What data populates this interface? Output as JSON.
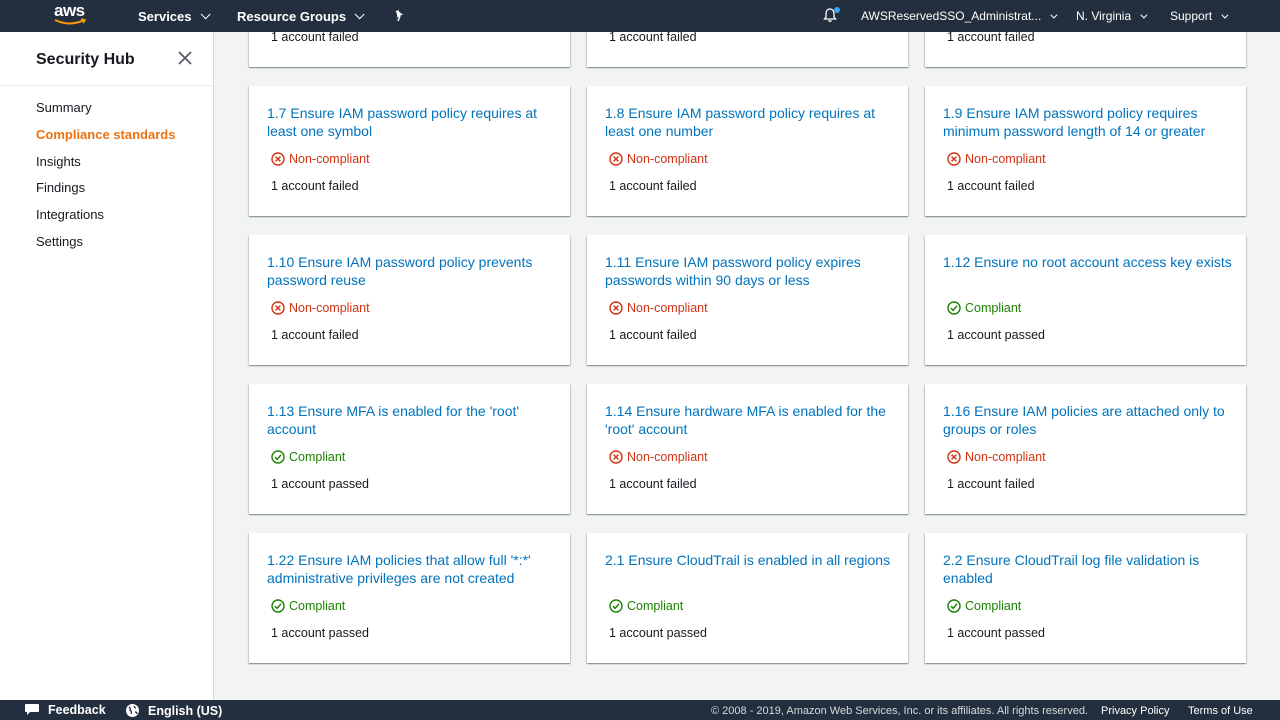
{
  "topnav": {
    "logo_text": "aws",
    "services": "Services",
    "resource_groups": "Resource Groups",
    "account": "AWSReservedSSO_Administrat...",
    "region": "N. Virginia",
    "support": "Support"
  },
  "sidebar": {
    "title": "Security Hub",
    "items": [
      {
        "label": "Summary"
      },
      {
        "label": "Compliance standards",
        "active": true
      },
      {
        "label": "Insights"
      },
      {
        "label": "Findings"
      },
      {
        "label": "Integrations"
      },
      {
        "label": "Settings"
      }
    ]
  },
  "partial_cards": [
    {
      "count": "1 account failed"
    },
    {
      "count": "1 account failed"
    },
    {
      "count": "1 account failed"
    }
  ],
  "cards": [
    {
      "title": "1.7 Ensure IAM password policy requires at least one symbol",
      "status": "Non-compliant",
      "count": "1 account failed"
    },
    {
      "title": "1.8 Ensure IAM password policy requires at least one number",
      "status": "Non-compliant",
      "count": "1 account failed"
    },
    {
      "title": "1.9 Ensure IAM password policy requires minimum password length of 14 or greater",
      "status": "Non-compliant",
      "count": "1 account failed"
    },
    {
      "title": "1.10 Ensure IAM password policy prevents password reuse",
      "status": "Non-compliant",
      "count": "1 account failed"
    },
    {
      "title": "1.11 Ensure IAM password policy expires passwords within 90 days or less",
      "status": "Non-compliant",
      "count": "1 account failed"
    },
    {
      "title": "1.12 Ensure no root account access key exists",
      "status": "Compliant",
      "count": "1 account passed"
    },
    {
      "title": "1.13 Ensure MFA is enabled for the 'root' account",
      "status": "Compliant",
      "count": "1 account passed"
    },
    {
      "title": "1.14 Ensure hardware MFA is enabled for the 'root' account",
      "status": "Non-compliant",
      "count": "1 account failed"
    },
    {
      "title": "1.16 Ensure IAM policies are attached only to groups or roles",
      "status": "Non-compliant",
      "count": "1 account failed"
    },
    {
      "title": "1.22 Ensure IAM policies that allow full '*:*' administrative privileges are not created",
      "status": "Compliant",
      "count": "1 account passed"
    },
    {
      "title": "2.1 Ensure CloudTrail is enabled in all regions",
      "status": "Compliant",
      "count": "1 account passed"
    },
    {
      "title": "2.2 Ensure CloudTrail log file validation is enabled",
      "status": "Compliant",
      "count": "1 account passed"
    }
  ],
  "footer": {
    "feedback": "Feedback",
    "language": "English (US)",
    "copyright": "© 2008 - 2019, Amazon Web Services, Inc. or its affiliates. All rights reserved.",
    "privacy": "Privacy Policy",
    "terms": "Terms of Use"
  },
  "colors": {
    "nav_bg": "#232f3e",
    "link": "#0073bb",
    "active": "#ec7211",
    "noncompliant": "#d13212",
    "compliant": "#1d8102"
  }
}
